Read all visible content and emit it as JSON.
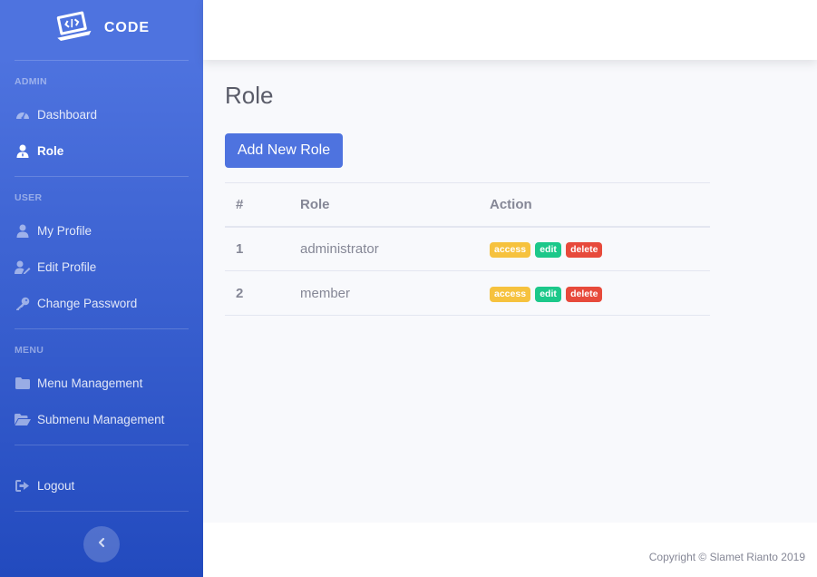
{
  "sidebar": {
    "brand": {
      "text": "CODE",
      "icon": "laptop-code-icon"
    },
    "headings": {
      "admin": "ADMIN",
      "user": "USER",
      "menu": "MENU"
    },
    "items": [
      {
        "label": "Dashboard",
        "icon": "tachometer-icon",
        "active": false
      },
      {
        "label": "Role",
        "icon": "user-tie-icon",
        "active": true
      },
      {
        "label": "My Profile",
        "icon": "user-icon",
        "active": false
      },
      {
        "label": "Edit Profile",
        "icon": "user-edit-icon",
        "active": false
      },
      {
        "label": "Change Password",
        "icon": "key-icon",
        "active": false
      },
      {
        "label": "Menu Management",
        "icon": "folder-icon",
        "active": false
      },
      {
        "label": "Submenu Management",
        "icon": "folder-open-icon",
        "active": false
      },
      {
        "label": "Logout",
        "icon": "sign-out-icon",
        "active": false
      }
    ],
    "toggle_icon": "chevron-left-icon"
  },
  "main": {
    "title": "Role",
    "add_button": "Add New Role",
    "table": {
      "headers": [
        "#",
        "Role",
        "Action"
      ],
      "rows": [
        {
          "num": "1",
          "role": "administrator",
          "actions": [
            "access",
            "edit",
            "delete"
          ]
        },
        {
          "num": "2",
          "role": "member",
          "actions": [
            "access",
            "edit",
            "delete"
          ]
        }
      ]
    }
  },
  "footer": {
    "copyright": "Copyright © Slamet Rianto 2019"
  },
  "colors": {
    "primary": "#4e73df",
    "warning": "#f6c23e",
    "success": "#1cc88a",
    "danger": "#e74a3b"
  }
}
